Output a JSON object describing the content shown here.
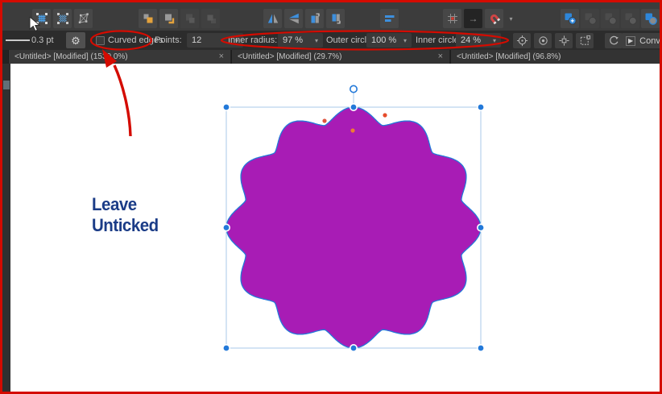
{
  "ui": {
    "close_glyph": "×",
    "caret": "▾",
    "gear": "⚙",
    "arrow_right": "→",
    "play": "▶"
  },
  "icons": {
    "pixel-grid-select": "blue grid with handles",
    "node-grid-select": "blue dotted grid with handles",
    "free-transform": "skewed box with cross",
    "move-to-front": "orange square over gray",
    "move-forward-one": "gray square over orange corner",
    "move-backward-one": "dim stacked squares",
    "move-to-back": "dim stacked squares",
    "flip-horizontal": "mirrored triangles",
    "flip-vertical": "stacked triangles",
    "rotate-counterclockwise": "split page with curl arrow",
    "rotate-clockwise": "split page with curl arrow",
    "align": "blue horizontal bars",
    "snap-grid": "grid with red dot",
    "move-by-whole-pixels": "→",
    "snapping-magnet": "red magnet",
    "geometry-add": "blue square plus circle",
    "geometry-subtract": "dim square minus circle",
    "geometry-intersect": "dim square and circle",
    "geometry-divide": "dim square and circle",
    "geometry-combine": "blue square with gray circle",
    "transform-origin": "crosshair circle",
    "hide-selection": "circle with dot",
    "show-handles": "square with cross arms",
    "transform-separately": "dashed square",
    "rotation": "circular arrow"
  },
  "context_bar": {
    "stroke_width": "0.3 pt",
    "curved_edges": {
      "label": "Curved edges",
      "checked": false
    },
    "points": {
      "label": "Points:",
      "value": "12"
    },
    "inner_radius": {
      "label": "Inner radius:",
      "value": "97 %"
    },
    "outer_circle": {
      "label": "Outer circle:",
      "value": "100 %"
    },
    "inner_circle": {
      "label": "Inner circle:",
      "value": "24 %"
    },
    "convert_label": "Convert to"
  },
  "tabs": [
    {
      "label": "<Untitled> [Modified] (1530.0%)"
    },
    {
      "label": "<Untitled> [Modified] (29.7%)"
    },
    {
      "label": "<Untitled> [Modified] (96.8%)"
    }
  ],
  "callout": {
    "line1": "Leave",
    "line2": "Unticked"
  },
  "shape": {
    "tool": "star",
    "points": 12,
    "fill": "#a81cb5"
  },
  "colors": {
    "annotation_red": "#d40b00",
    "callout_navy": "#1b3c87",
    "selection_blue": "#2379d9",
    "bbox_line": "#a9c9ea",
    "node_orange": "#e64b2b",
    "node_orange_light": "#ee7b33",
    "node_orange_soft": "#df5540",
    "toolbar_icon_blue": "#3d8fdd"
  }
}
